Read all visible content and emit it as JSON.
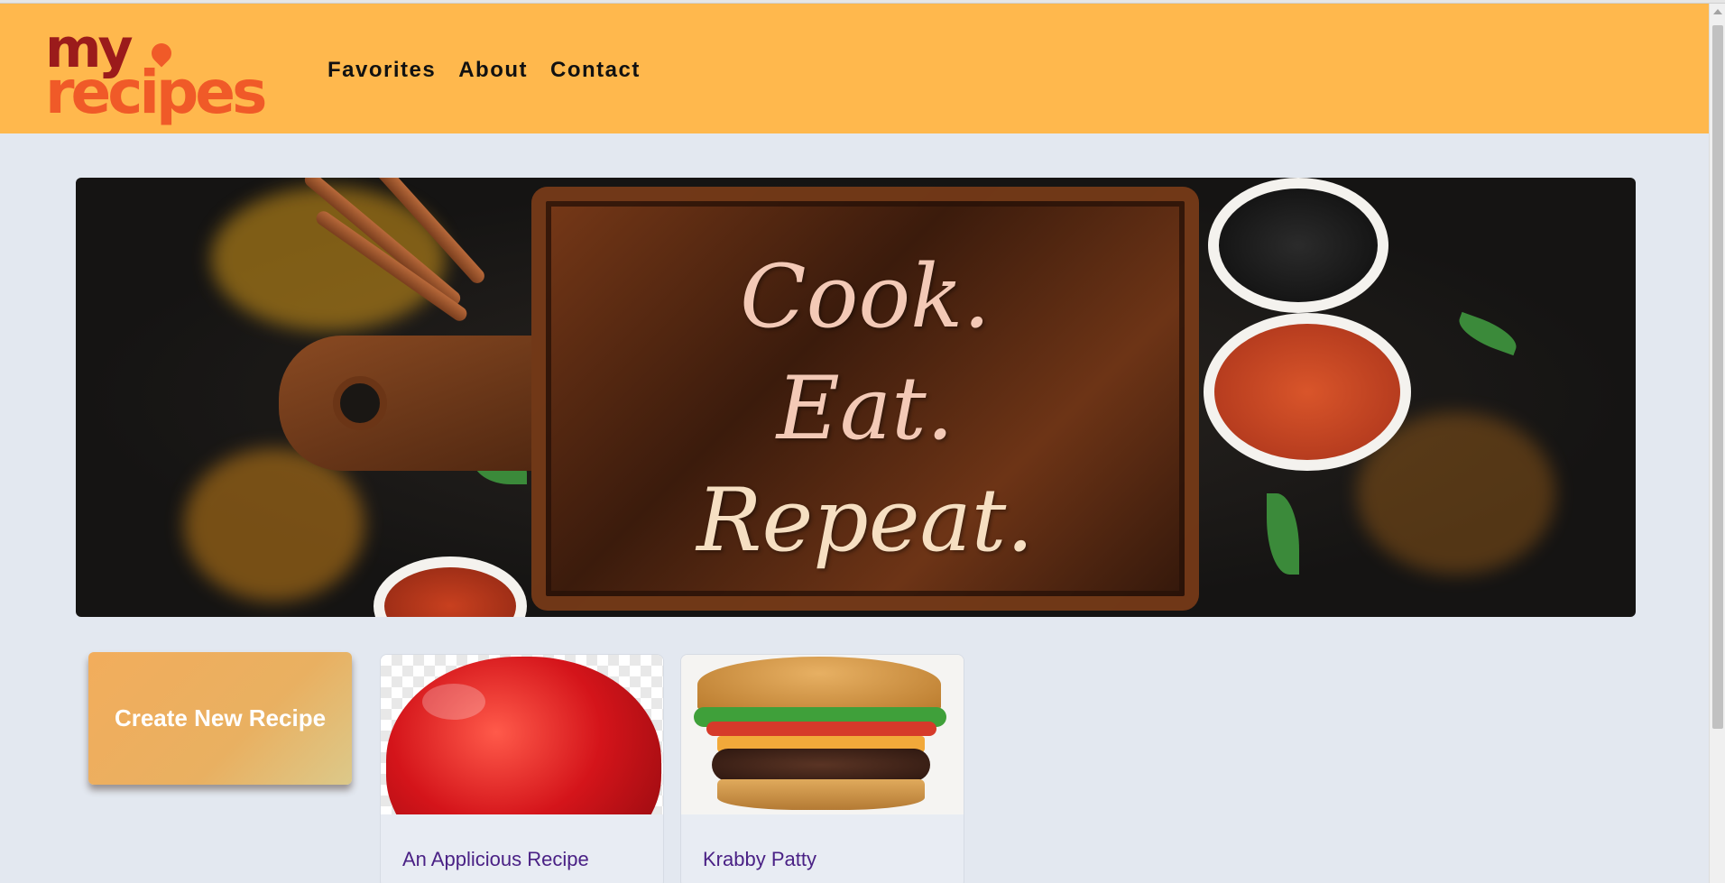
{
  "logo": {
    "line1": "my",
    "line2": "recipes"
  },
  "nav": {
    "items": [
      "Favorites",
      "About",
      "Contact"
    ]
  },
  "hero": {
    "lines": [
      "Cook.",
      "Eat.",
      "Repeat."
    ]
  },
  "actions": {
    "create_label": "Create New Recipe"
  },
  "recipes": [
    {
      "title": "An Applicious Recipe",
      "image": "apple"
    },
    {
      "title": "Krabby Patty",
      "image": "burger"
    }
  ],
  "colors": {
    "header": "#ffb84d",
    "background": "#e3e8f0",
    "logo_dark": "#9b1b1b",
    "logo_orange": "#f05a28",
    "recipe_link": "#4a2185"
  }
}
